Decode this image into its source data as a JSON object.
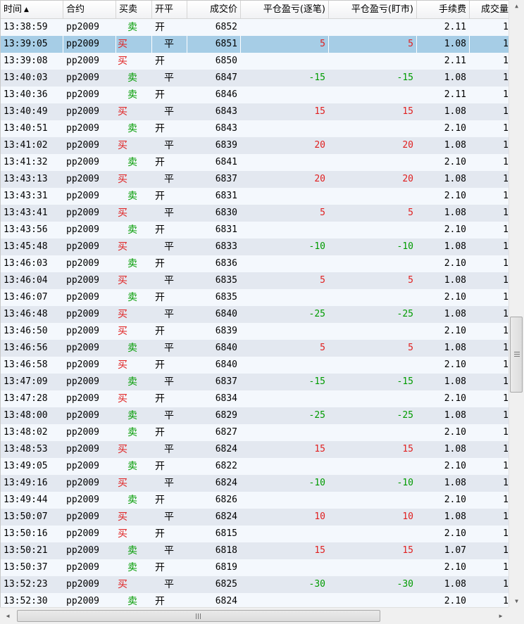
{
  "columns": {
    "time": "时间",
    "time_sort": "▲",
    "contract": "合约",
    "buy_sell": "买卖",
    "open_close": "开平",
    "price": "成交价",
    "pnl_trade": "平仓盈亏(逐笔)",
    "pnl_mark": "平仓盈亏(盯市)",
    "fee": "手续费",
    "volume": "成交量"
  },
  "selected_row": 1,
  "rows": [
    {
      "time": "13:38:59",
      "contract": "pp2009",
      "side": "卖",
      "oc": "开",
      "price": "6852",
      "pnl_trade": "",
      "pnl_mark": "",
      "fee": "2.11",
      "volume": "1"
    },
    {
      "time": "13:39:05",
      "contract": "pp2009",
      "side": "买",
      "oc": "平",
      "price": "6851",
      "pnl_trade": "5",
      "pnl_mark": "5",
      "fee": "1.08",
      "volume": "1"
    },
    {
      "time": "13:39:08",
      "contract": "pp2009",
      "side": "买",
      "oc": "开",
      "price": "6850",
      "pnl_trade": "",
      "pnl_mark": "",
      "fee": "2.11",
      "volume": "1"
    },
    {
      "time": "13:40:03",
      "contract": "pp2009",
      "side": "卖",
      "oc": "平",
      "price": "6847",
      "pnl_trade": "-15",
      "pnl_mark": "-15",
      "fee": "1.08",
      "volume": "1"
    },
    {
      "time": "13:40:36",
      "contract": "pp2009",
      "side": "卖",
      "oc": "开",
      "price": "6846",
      "pnl_trade": "",
      "pnl_mark": "",
      "fee": "2.11",
      "volume": "1"
    },
    {
      "time": "13:40:49",
      "contract": "pp2009",
      "side": "买",
      "oc": "平",
      "price": "6843",
      "pnl_trade": "15",
      "pnl_mark": "15",
      "fee": "1.08",
      "volume": "1"
    },
    {
      "time": "13:40:51",
      "contract": "pp2009",
      "side": "卖",
      "oc": "开",
      "price": "6843",
      "pnl_trade": "",
      "pnl_mark": "",
      "fee": "2.10",
      "volume": "1"
    },
    {
      "time": "13:41:02",
      "contract": "pp2009",
      "side": "买",
      "oc": "平",
      "price": "6839",
      "pnl_trade": "20",
      "pnl_mark": "20",
      "fee": "1.08",
      "volume": "1"
    },
    {
      "time": "13:41:32",
      "contract": "pp2009",
      "side": "卖",
      "oc": "开",
      "price": "6841",
      "pnl_trade": "",
      "pnl_mark": "",
      "fee": "2.10",
      "volume": "1"
    },
    {
      "time": "13:43:13",
      "contract": "pp2009",
      "side": "买",
      "oc": "平",
      "price": "6837",
      "pnl_trade": "20",
      "pnl_mark": "20",
      "fee": "1.08",
      "volume": "1"
    },
    {
      "time": "13:43:31",
      "contract": "pp2009",
      "side": "卖",
      "oc": "开",
      "price": "6831",
      "pnl_trade": "",
      "pnl_mark": "",
      "fee": "2.10",
      "volume": "1"
    },
    {
      "time": "13:43:41",
      "contract": "pp2009",
      "side": "买",
      "oc": "平",
      "price": "6830",
      "pnl_trade": "5",
      "pnl_mark": "5",
      "fee": "1.08",
      "volume": "1"
    },
    {
      "time": "13:43:56",
      "contract": "pp2009",
      "side": "卖",
      "oc": "开",
      "price": "6831",
      "pnl_trade": "",
      "pnl_mark": "",
      "fee": "2.10",
      "volume": "1"
    },
    {
      "time": "13:45:48",
      "contract": "pp2009",
      "side": "买",
      "oc": "平",
      "price": "6833",
      "pnl_trade": "-10",
      "pnl_mark": "-10",
      "fee": "1.08",
      "volume": "1"
    },
    {
      "time": "13:46:03",
      "contract": "pp2009",
      "side": "卖",
      "oc": "开",
      "price": "6836",
      "pnl_trade": "",
      "pnl_mark": "",
      "fee": "2.10",
      "volume": "1"
    },
    {
      "time": "13:46:04",
      "contract": "pp2009",
      "side": "买",
      "oc": "平",
      "price": "6835",
      "pnl_trade": "5",
      "pnl_mark": "5",
      "fee": "1.08",
      "volume": "1"
    },
    {
      "time": "13:46:07",
      "contract": "pp2009",
      "side": "卖",
      "oc": "开",
      "price": "6835",
      "pnl_trade": "",
      "pnl_mark": "",
      "fee": "2.10",
      "volume": "1"
    },
    {
      "time": "13:46:48",
      "contract": "pp2009",
      "side": "买",
      "oc": "平",
      "price": "6840",
      "pnl_trade": "-25",
      "pnl_mark": "-25",
      "fee": "1.08",
      "volume": "1"
    },
    {
      "time": "13:46:50",
      "contract": "pp2009",
      "side": "买",
      "oc": "开",
      "price": "6839",
      "pnl_trade": "",
      "pnl_mark": "",
      "fee": "2.10",
      "volume": "1"
    },
    {
      "time": "13:46:56",
      "contract": "pp2009",
      "side": "卖",
      "oc": "平",
      "price": "6840",
      "pnl_trade": "5",
      "pnl_mark": "5",
      "fee": "1.08",
      "volume": "1"
    },
    {
      "time": "13:46:58",
      "contract": "pp2009",
      "side": "买",
      "oc": "开",
      "price": "6840",
      "pnl_trade": "",
      "pnl_mark": "",
      "fee": "2.10",
      "volume": "1"
    },
    {
      "time": "13:47:09",
      "contract": "pp2009",
      "side": "卖",
      "oc": "平",
      "price": "6837",
      "pnl_trade": "-15",
      "pnl_mark": "-15",
      "fee": "1.08",
      "volume": "1"
    },
    {
      "time": "13:47:28",
      "contract": "pp2009",
      "side": "买",
      "oc": "开",
      "price": "6834",
      "pnl_trade": "",
      "pnl_mark": "",
      "fee": "2.10",
      "volume": "1"
    },
    {
      "time": "13:48:00",
      "contract": "pp2009",
      "side": "卖",
      "oc": "平",
      "price": "6829",
      "pnl_trade": "-25",
      "pnl_mark": "-25",
      "fee": "1.08",
      "volume": "1"
    },
    {
      "time": "13:48:02",
      "contract": "pp2009",
      "side": "卖",
      "oc": "开",
      "price": "6827",
      "pnl_trade": "",
      "pnl_mark": "",
      "fee": "2.10",
      "volume": "1"
    },
    {
      "time": "13:48:53",
      "contract": "pp2009",
      "side": "买",
      "oc": "平",
      "price": "6824",
      "pnl_trade": "15",
      "pnl_mark": "15",
      "fee": "1.08",
      "volume": "1"
    },
    {
      "time": "13:49:05",
      "contract": "pp2009",
      "side": "卖",
      "oc": "开",
      "price": "6822",
      "pnl_trade": "",
      "pnl_mark": "",
      "fee": "2.10",
      "volume": "1"
    },
    {
      "time": "13:49:16",
      "contract": "pp2009",
      "side": "买",
      "oc": "平",
      "price": "6824",
      "pnl_trade": "-10",
      "pnl_mark": "-10",
      "fee": "1.08",
      "volume": "1"
    },
    {
      "time": "13:49:44",
      "contract": "pp2009",
      "side": "卖",
      "oc": "开",
      "price": "6826",
      "pnl_trade": "",
      "pnl_mark": "",
      "fee": "2.10",
      "volume": "1"
    },
    {
      "time": "13:50:07",
      "contract": "pp2009",
      "side": "买",
      "oc": "平",
      "price": "6824",
      "pnl_trade": "10",
      "pnl_mark": "10",
      "fee": "1.08",
      "volume": "1"
    },
    {
      "time": "13:50:16",
      "contract": "pp2009",
      "side": "买",
      "oc": "开",
      "price": "6815",
      "pnl_trade": "",
      "pnl_mark": "",
      "fee": "2.10",
      "volume": "1"
    },
    {
      "time": "13:50:21",
      "contract": "pp2009",
      "side": "卖",
      "oc": "平",
      "price": "6818",
      "pnl_trade": "15",
      "pnl_mark": "15",
      "fee": "1.07",
      "volume": "1"
    },
    {
      "time": "13:50:37",
      "contract": "pp2009",
      "side": "卖",
      "oc": "开",
      "price": "6819",
      "pnl_trade": "",
      "pnl_mark": "",
      "fee": "2.10",
      "volume": "1"
    },
    {
      "time": "13:52:23",
      "contract": "pp2009",
      "side": "买",
      "oc": "平",
      "price": "6825",
      "pnl_trade": "-30",
      "pnl_mark": "-30",
      "fee": "1.08",
      "volume": "1"
    },
    {
      "time": "13:52:30",
      "contract": "pp2009",
      "side": "卖",
      "oc": "开",
      "price": "6824",
      "pnl_trade": "",
      "pnl_mark": "",
      "fee": "2.10",
      "volume": "1"
    }
  ],
  "colors": {
    "buy": "#e02020",
    "sell": "#009b00",
    "profit": "#e02020",
    "loss": "#009b00",
    "selected_row": "#a6cde6",
    "row_odd": "#f4f8fd",
    "row_even": "#e3e8f0"
  },
  "scrollbars": {
    "vertical_up": "▲",
    "vertical_down": "▼",
    "horizontal_left": "◀",
    "horizontal_right": "▶",
    "vertical_position": 0.6,
    "horizontal_position": 0.0
  }
}
